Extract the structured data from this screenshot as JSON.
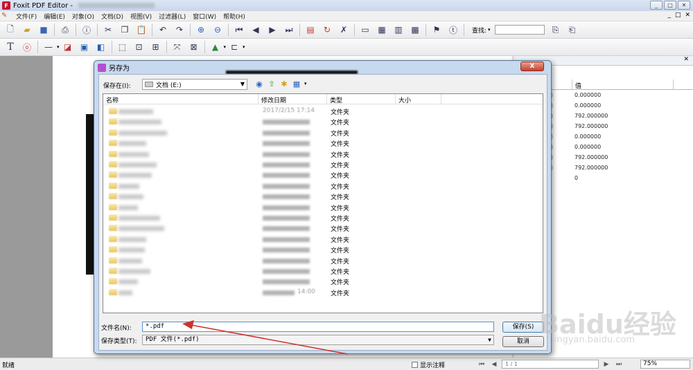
{
  "app": {
    "logo": "F",
    "title": "Foxit PDF Editor - ",
    "window_controls": [
      "_",
      "□",
      "✕"
    ]
  },
  "menubar": {
    "items": [
      "文件(F)",
      "编辑(E)",
      "对象(O)",
      "文档(D)",
      "视图(V)",
      "过滤器(L)",
      "窗口(W)",
      "帮助(H)"
    ],
    "right_controls": [
      "_",
      "□",
      "✕"
    ]
  },
  "toolbar1": {
    "find_label": "查找:"
  },
  "properties_panel": {
    "value_header": "值",
    "values": [
      "0.000000",
      "0.000000",
      "792.000000",
      "792.000000",
      "0.000000",
      "0.000000",
      "792.000000",
      "792.000000",
      "0"
    ]
  },
  "dialog": {
    "title": "另存为",
    "close_label": "X",
    "save_in_label": "保存在(I):",
    "save_in_value": "文档 (E:)",
    "columns": [
      "名称",
      "修改日期",
      "类型",
      "大小"
    ],
    "first_row_date": "2017/2/15 17:14",
    "last_row_date": "14:00",
    "folder_type": "文件夹",
    "row_count": 18,
    "file_name_label": "文件名(N):",
    "file_name_value": "*.pdf",
    "file_type_label": "保存类型(T):",
    "file_type_value": "PDF 文件(*.pdf)",
    "save_button": "保存(S)",
    "cancel_button": "取消"
  },
  "statusbar": {
    "status": "就绪",
    "show_notes": "显示注释",
    "page": "1 / 1",
    "zoom": "75%"
  },
  "watermark": {
    "brand": "Baidu经验",
    "url": "jingyan.baidu.com"
  },
  "colors": {
    "dialog_frame": "#c7d9ee",
    "close_button": "#c4412d",
    "annotation_arrow": "#d0302a"
  }
}
